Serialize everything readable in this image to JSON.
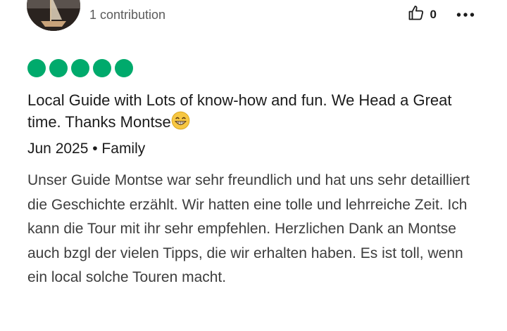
{
  "review": {
    "contributions": "1 contribution",
    "helpful_count": "0",
    "rating": 5,
    "rating_max": 5,
    "title": "Local Guide with Lots of know-how and fun. We Head a Great time. Thanks Montse",
    "title_emoji": "grinning-face-with-smiling-eyes",
    "meta": "Jun 2025 • Family",
    "text": "Unser Guide Montse war sehr freundlich und hat uns sehr detailliert die Geschichte erzählt. Wir hatten eine tolle und lehrreiche Zeit. Ich kann die Tour mit ihr sehr empfehlen. Herzlichen Dank an Montse auch bzgl der vielen Tipps, die wir erhalten haben. Es ist toll, wenn ein local solche Touren macht."
  },
  "icons": {
    "like": "thumbs-up-icon",
    "more": "more-horizontal-icon"
  },
  "colors": {
    "rating_bubble": "#00aa6c",
    "text_primary": "#1b1b1b",
    "text_secondary": "#5b5b5b"
  }
}
